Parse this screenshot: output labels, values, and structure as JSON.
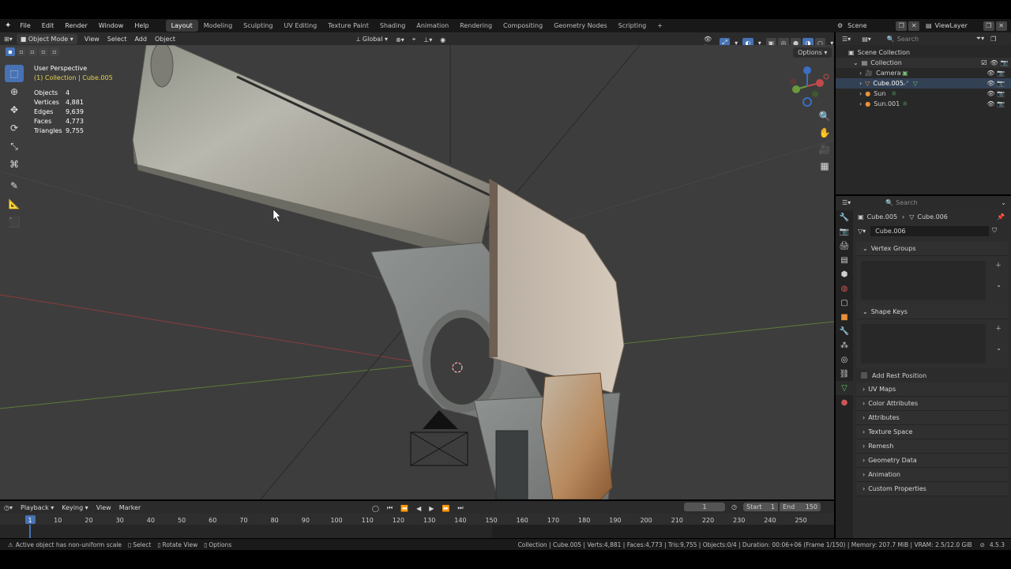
{
  "topbar": {
    "menus": [
      "File",
      "Edit",
      "Render",
      "Window",
      "Help"
    ],
    "workspaces": [
      "Layout",
      "Modeling",
      "Sculpting",
      "UV Editing",
      "Texture Paint",
      "Shading",
      "Animation",
      "Rendering",
      "Compositing",
      "Geometry Nodes",
      "Scripting"
    ],
    "active_workspace": "Layout",
    "add_tab": "+",
    "scene": "Scene",
    "view_layer": "ViewLayer"
  },
  "viewport_header": {
    "mode": "Object Mode",
    "menus": [
      "View",
      "Select",
      "Add",
      "Object"
    ],
    "orientation": "Global",
    "options": "Options"
  },
  "overlay": {
    "view_name": "User Perspective",
    "collection_line": "(1) Collection | Cube.005",
    "stats": [
      {
        "label": "Objects",
        "value": "4"
      },
      {
        "label": "Vertices",
        "value": "4,881"
      },
      {
        "label": "Edges",
        "value": "9,639"
      },
      {
        "label": "Faces",
        "value": "4,773"
      },
      {
        "label": "Triangles",
        "value": "9,755"
      }
    ]
  },
  "outliner": {
    "search_placeholder": "Search",
    "scene_collection": "Scene Collection",
    "collection": "Collection",
    "items": [
      "Camera",
      "Cube.005",
      "Sun",
      "Sun.001"
    ]
  },
  "properties": {
    "search_placeholder": "Search",
    "breadcrumb_object": "Cube.005",
    "breadcrumb_data": "Cube.006",
    "data_name": "Cube.006",
    "vertex_groups": "Vertex Groups",
    "shape_keys": "Shape Keys",
    "add_rest_position": "Add Rest Position",
    "panels": [
      "UV Maps",
      "Color Attributes",
      "Attributes",
      "Texture Space",
      "Remesh",
      "Geometry Data",
      "Animation",
      "Custom Properties"
    ]
  },
  "timeline": {
    "menus": [
      "Playback",
      "Keying",
      "View",
      "Marker"
    ],
    "current_frame": "1",
    "start_label": "Start",
    "start_value": "1",
    "end_label": "End",
    "end_value": "150",
    "ruler": [
      "1",
      "10",
      "20",
      "30",
      "40",
      "50",
      "60",
      "70",
      "80",
      "90",
      "100",
      "110",
      "120",
      "130",
      "140",
      "150",
      "160",
      "170",
      "180",
      "190",
      "200",
      "210",
      "220",
      "230",
      "240",
      "250"
    ]
  },
  "statusbar": {
    "message": "Active object has non-uniform scale",
    "select": "Select",
    "rotate": "Rotate View",
    "options": "Options",
    "info": "Collection | Cube.005 | Verts:4,881 | Faces:4,773 | Tris:9,755 | Objects:0/4 | Duration: 00:06+06 (Frame 1/150) | Memory: 207.7 MiB | VRAM: 2.5/12.0 GiB",
    "version": "4.5.3"
  },
  "colors": {
    "accent_blue": "#4772b3",
    "active_object_text": "#e8d24a",
    "viewport_bg": "#3d3d3d"
  }
}
